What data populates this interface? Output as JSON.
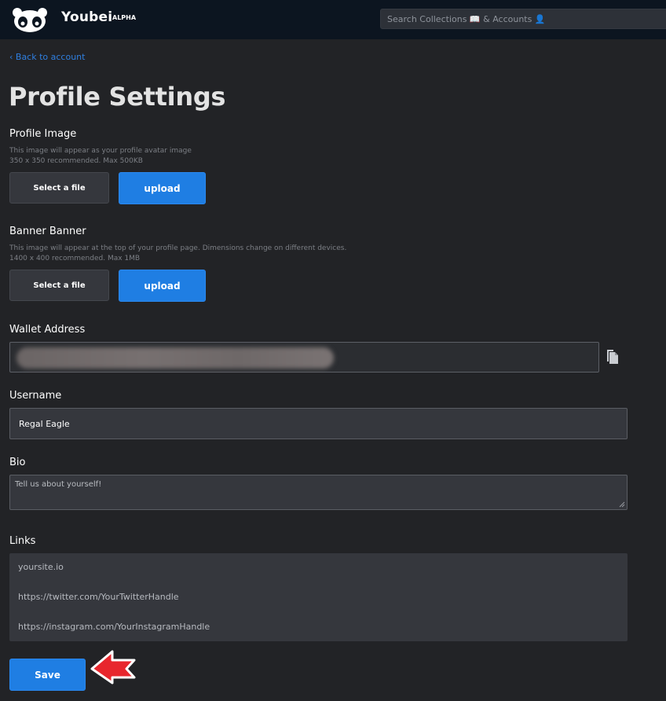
{
  "app": {
    "brand": "Youbei",
    "badge": "ALPHA",
    "search_placeholder": "Search Collections 📖 & Accounts 👤"
  },
  "nav": {
    "back_link": "‹ Back to account"
  },
  "page": {
    "title": "Profile Settings"
  },
  "profile_image": {
    "label": "Profile Image",
    "hint_1": "This image will appear as your profile avatar image",
    "hint_2": "350 x 350 recommended. Max 500KB",
    "select_label": "Select a file",
    "upload_label": "upload"
  },
  "banner_image": {
    "label": "Banner Banner",
    "hint_1": "This image will appear at the top of your profile page. Dimensions change on different devices.",
    "hint_2": "1400 x 400 recommended. Max 1MB",
    "select_label": "Select a file",
    "upload_label": "upload"
  },
  "wallet": {
    "label": "Wallet Address",
    "value_redacted": true,
    "copy_icon": "copy-icon"
  },
  "username": {
    "label": "Username",
    "value": "Regal Eagle"
  },
  "bio": {
    "label": "Bio",
    "placeholder": "Tell us about yourself!"
  },
  "links": {
    "label": "Links",
    "items": [
      "yoursite.io",
      "https://twitter.com/YourTwitterHandle",
      "https://instagram.com/YourInstagramHandle"
    ]
  },
  "actions": {
    "save_label": "Save"
  },
  "colors": {
    "background": "#222326",
    "topbar": "#0c1520",
    "accent": "#1f7ee3",
    "link": "#2f7fe0",
    "annotation_arrow": "#e8262d"
  }
}
